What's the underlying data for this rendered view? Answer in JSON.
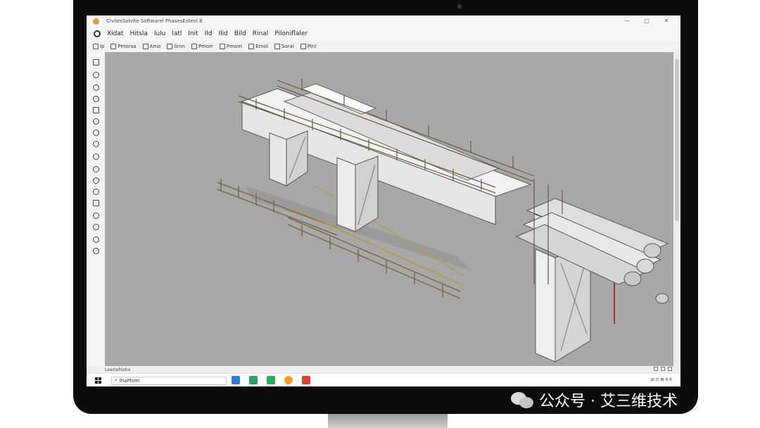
{
  "window": {
    "title": "CivilesSolvite Softwarel  PhasesEstenl 8",
    "controls": [
      "—",
      "□",
      "✕"
    ]
  },
  "menubar": {
    "items": [
      "Xidat",
      "Hitsla",
      "lulu",
      "latl",
      "lnit",
      "Ild",
      "Ilid",
      "Bild",
      "Rinal",
      "Piloniflaler"
    ]
  },
  "toolbar": {
    "items": [
      "lp",
      "Pmorsa",
      "Amo",
      "lirnn",
      "Pmorr",
      "Pmom",
      "Ernol",
      "Soral",
      "Pinl"
    ]
  },
  "viewport": {
    "background": "#a8a8a8",
    "model": "3d-bridge-structure-model"
  },
  "statusbar": {
    "left_text": "Loarlalhisha"
  },
  "taskbar": {
    "search_text": "lhaPhim",
    "apps": [
      {
        "name": "file-manager-app",
        "color": "#2f7bd8"
      },
      {
        "name": "editor-app",
        "color": "#2f9a64"
      },
      {
        "name": "chat-app",
        "color": "#25b05a"
      },
      {
        "name": "browser-app",
        "color": "#f0a020"
      },
      {
        "name": "mail-app",
        "color": "#d8412f"
      }
    ],
    "tray_text": "⊞ ⊡ ⊠ 8 8"
  },
  "watermark": {
    "text": "公众号 · 艾三维技术"
  }
}
